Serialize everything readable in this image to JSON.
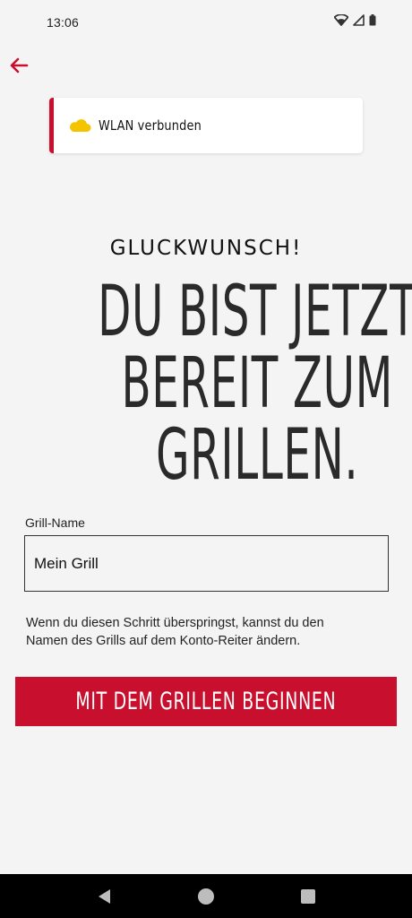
{
  "status_bar": {
    "time": "13:06",
    "icons": [
      "wifi-icon",
      "cellular-signal-icon",
      "battery-icon"
    ]
  },
  "header": {
    "back_icon": "arrow-left-icon"
  },
  "connection_card": {
    "icon": "cloud-icon",
    "label": "WLAN verbunden"
  },
  "main": {
    "congrats": "GLUCKWUNSCH!",
    "headline_lines": [
      "DU BIST JETZT",
      "BEREIT ZUM",
      "GRILLEN."
    ]
  },
  "form": {
    "grill_name_label": "Grill-Name",
    "grill_name_value": "Mein Grill",
    "hint": "Wenn du diesen Schritt überspringst, kannst du den Namen des Grills auf dem Konto-Reiter ändern."
  },
  "actions": {
    "start_label": "MIT DEM GRILLEN BEGINNEN"
  },
  "colors": {
    "accent": "#c8102e",
    "background": "#f4f4f4",
    "cloud": "#f5c400"
  }
}
